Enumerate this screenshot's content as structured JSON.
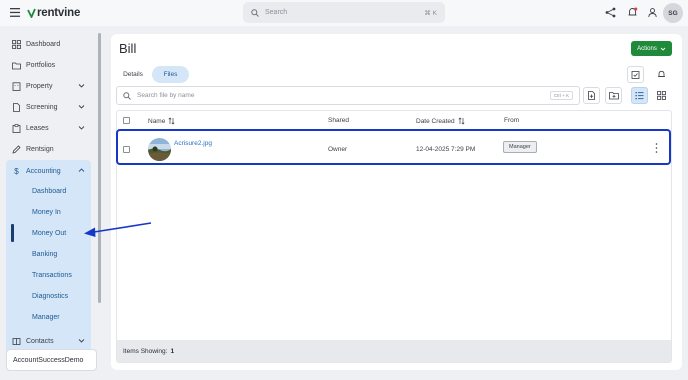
{
  "app": {
    "brand": "rentvine"
  },
  "topbar": {
    "search_placeholder": "Search",
    "search_shortcut": "⌘ K",
    "icons": [
      "menu-icon",
      "share-nodes-icon",
      "bell-icon",
      "user-icon"
    ],
    "avatar_initials": "SG"
  },
  "sidebar": {
    "items": [
      {
        "label": "Dashboard",
        "icon": "grid-icon"
      },
      {
        "label": "Portfolios",
        "icon": "folder-icon"
      },
      {
        "label": "Property",
        "icon": "building-icon",
        "expandable": true
      },
      {
        "label": "Screening",
        "icon": "document-icon",
        "expandable": true
      },
      {
        "label": "Leases",
        "icon": "clipboard-icon",
        "expandable": true
      },
      {
        "label": "Rentsign",
        "icon": "pen-icon"
      },
      {
        "label": "Accounting",
        "icon": "dollar-icon",
        "expanded": true
      },
      {
        "label": "Contacts",
        "icon": "address-book-icon",
        "expandable": true
      }
    ],
    "accounting_sub": [
      {
        "label": "Dashboard"
      },
      {
        "label": "Money In"
      },
      {
        "label": "Money Out",
        "active": true
      },
      {
        "label": "Banking"
      },
      {
        "label": "Transactions"
      },
      {
        "label": "Diagnostics"
      },
      {
        "label": "Manager"
      }
    ],
    "org_name": "AccountSuccessDemo"
  },
  "page": {
    "title": "Bill",
    "actions_label": "Actions",
    "tabs": [
      {
        "label": "Details"
      },
      {
        "label": "Files",
        "active": true
      }
    ],
    "file_search_placeholder": "Search file by name",
    "file_search_shortcut": "Ctrl + K",
    "table": {
      "columns": [
        "Name",
        "Shared",
        "Date Created",
        "From"
      ],
      "rows": [
        {
          "name": "Acrisure2.jpg",
          "shared": "Owner",
          "date_created": "12-04-2025 7:29 PM",
          "from": "Manager"
        }
      ],
      "footer_label": "Items Showing:",
      "footer_count": "1"
    }
  },
  "colors": {
    "accent_blue": "#1f5a94",
    "sub_nav_bg": "#d4e6f7",
    "actions_green": "#1f8a3a",
    "highlight_blue": "#1638c9"
  }
}
